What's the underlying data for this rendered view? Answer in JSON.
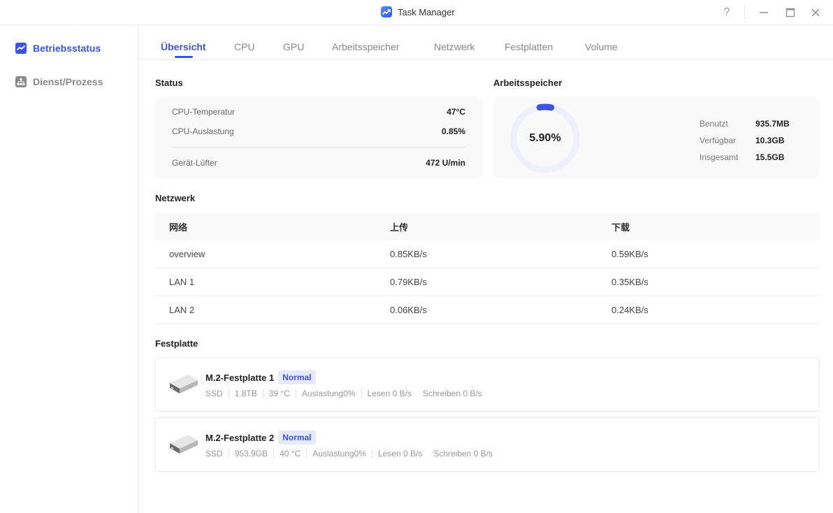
{
  "window": {
    "title": "Task Manager",
    "app_icon": "chart-trend-icon",
    "controls": {
      "help": "?",
      "minimize": "—",
      "maximize": "☐",
      "close": "✕"
    }
  },
  "sidebar": {
    "items": [
      {
        "label": "Betriebsstatus",
        "icon": "trend-chart-icon",
        "active": true
      },
      {
        "label": "Dienst/Prozess",
        "icon": "hierarchy-icon",
        "active": false
      }
    ]
  },
  "tabs": [
    {
      "label": "Übersicht",
      "active": true
    },
    {
      "label": "CPU"
    },
    {
      "label": "GPU"
    },
    {
      "label": "Arbeitsspeicher"
    },
    {
      "label": "Netzwerk"
    },
    {
      "label": "Festplatten"
    },
    {
      "label": "Volume"
    }
  ],
  "status": {
    "title": "Status",
    "rows": [
      {
        "label": "CPU-Temperatur",
        "value": "47°C"
      },
      {
        "label": "CPU-Auslastung",
        "value": "0.85%"
      },
      {
        "label": "Gerät-Lüfter",
        "value": "472 U/min"
      }
    ]
  },
  "memory": {
    "title": "Arbeitsspeicher",
    "usage_percent_label": "5.90%",
    "usage_fraction": 0.059,
    "colors": {
      "accent": "#3d54e0",
      "track": "#eef0fb"
    },
    "rows": [
      {
        "label": "Benutzt",
        "value": "935.7MB"
      },
      {
        "label": "Verfügbar",
        "value": "10.3GB"
      },
      {
        "label": "Insgesamt",
        "value": "15.5GB"
      }
    ]
  },
  "network": {
    "title": "Netzwerk",
    "headers": [
      "网络",
      "上传",
      "下载"
    ],
    "rows": [
      [
        "overview",
        "0.85KB/s",
        "0.59KB/s"
      ],
      [
        "LAN 1",
        "0.79KB/s",
        "0.35KB/s"
      ],
      [
        "LAN 2",
        "0.06KB/s",
        "0.24KB/s"
      ]
    ]
  },
  "disks": {
    "title": "Festplatte",
    "items": [
      {
        "name": "M.2-Festplatte 1",
        "status": "Normal",
        "type": "SSD",
        "size": "1.8TB",
        "temp": "39 °C",
        "load": "Auslastung0%",
        "read": "Lesen 0 B/s",
        "write": "Schreiben 0 B/s"
      },
      {
        "name": "M.2-Festplatte 2",
        "status": "Normal",
        "type": "SSD",
        "size": "953.9GB",
        "temp": "40 °C",
        "load": "Auslastung0%",
        "read": "Lesen 0 B/s",
        "write": "Schreiben 0 B/s"
      }
    ]
  }
}
